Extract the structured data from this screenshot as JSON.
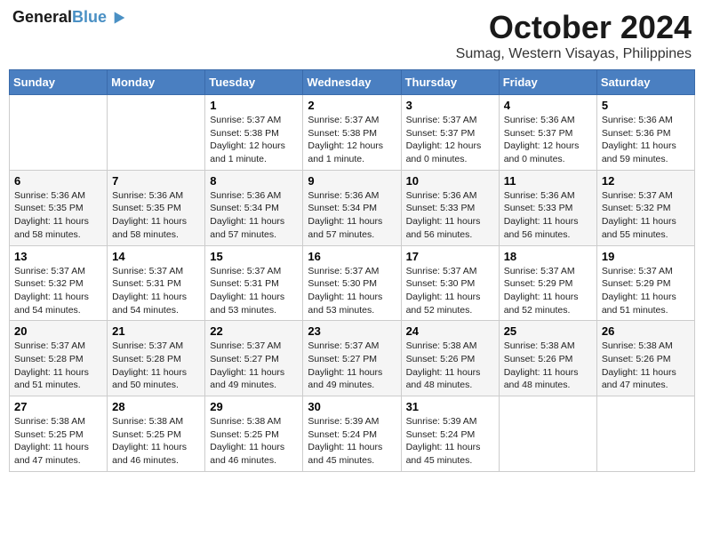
{
  "header": {
    "logo_line1": "General",
    "logo_line2": "Blue",
    "month_title": "October 2024",
    "location": "Sumag, Western Visayas, Philippines"
  },
  "weekdays": [
    "Sunday",
    "Monday",
    "Tuesday",
    "Wednesday",
    "Thursday",
    "Friday",
    "Saturday"
  ],
  "weeks": [
    [
      {
        "day": "",
        "text": ""
      },
      {
        "day": "",
        "text": ""
      },
      {
        "day": "1",
        "text": "Sunrise: 5:37 AM\nSunset: 5:38 PM\nDaylight: 12 hours\nand 1 minute."
      },
      {
        "day": "2",
        "text": "Sunrise: 5:37 AM\nSunset: 5:38 PM\nDaylight: 12 hours\nand 1 minute."
      },
      {
        "day": "3",
        "text": "Sunrise: 5:37 AM\nSunset: 5:37 PM\nDaylight: 12 hours\nand 0 minutes."
      },
      {
        "day": "4",
        "text": "Sunrise: 5:36 AM\nSunset: 5:37 PM\nDaylight: 12 hours\nand 0 minutes."
      },
      {
        "day": "5",
        "text": "Sunrise: 5:36 AM\nSunset: 5:36 PM\nDaylight: 11 hours\nand 59 minutes."
      }
    ],
    [
      {
        "day": "6",
        "text": "Sunrise: 5:36 AM\nSunset: 5:35 PM\nDaylight: 11 hours\nand 58 minutes."
      },
      {
        "day": "7",
        "text": "Sunrise: 5:36 AM\nSunset: 5:35 PM\nDaylight: 11 hours\nand 58 minutes."
      },
      {
        "day": "8",
        "text": "Sunrise: 5:36 AM\nSunset: 5:34 PM\nDaylight: 11 hours\nand 57 minutes."
      },
      {
        "day": "9",
        "text": "Sunrise: 5:36 AM\nSunset: 5:34 PM\nDaylight: 11 hours\nand 57 minutes."
      },
      {
        "day": "10",
        "text": "Sunrise: 5:36 AM\nSunset: 5:33 PM\nDaylight: 11 hours\nand 56 minutes."
      },
      {
        "day": "11",
        "text": "Sunrise: 5:36 AM\nSunset: 5:33 PM\nDaylight: 11 hours\nand 56 minutes."
      },
      {
        "day": "12",
        "text": "Sunrise: 5:37 AM\nSunset: 5:32 PM\nDaylight: 11 hours\nand 55 minutes."
      }
    ],
    [
      {
        "day": "13",
        "text": "Sunrise: 5:37 AM\nSunset: 5:32 PM\nDaylight: 11 hours\nand 54 minutes."
      },
      {
        "day": "14",
        "text": "Sunrise: 5:37 AM\nSunset: 5:31 PM\nDaylight: 11 hours\nand 54 minutes."
      },
      {
        "day": "15",
        "text": "Sunrise: 5:37 AM\nSunset: 5:31 PM\nDaylight: 11 hours\nand 53 minutes."
      },
      {
        "day": "16",
        "text": "Sunrise: 5:37 AM\nSunset: 5:30 PM\nDaylight: 11 hours\nand 53 minutes."
      },
      {
        "day": "17",
        "text": "Sunrise: 5:37 AM\nSunset: 5:30 PM\nDaylight: 11 hours\nand 52 minutes."
      },
      {
        "day": "18",
        "text": "Sunrise: 5:37 AM\nSunset: 5:29 PM\nDaylight: 11 hours\nand 52 minutes."
      },
      {
        "day": "19",
        "text": "Sunrise: 5:37 AM\nSunset: 5:29 PM\nDaylight: 11 hours\nand 51 minutes."
      }
    ],
    [
      {
        "day": "20",
        "text": "Sunrise: 5:37 AM\nSunset: 5:28 PM\nDaylight: 11 hours\nand 51 minutes."
      },
      {
        "day": "21",
        "text": "Sunrise: 5:37 AM\nSunset: 5:28 PM\nDaylight: 11 hours\nand 50 minutes."
      },
      {
        "day": "22",
        "text": "Sunrise: 5:37 AM\nSunset: 5:27 PM\nDaylight: 11 hours\nand 49 minutes."
      },
      {
        "day": "23",
        "text": "Sunrise: 5:37 AM\nSunset: 5:27 PM\nDaylight: 11 hours\nand 49 minutes."
      },
      {
        "day": "24",
        "text": "Sunrise: 5:38 AM\nSunset: 5:26 PM\nDaylight: 11 hours\nand 48 minutes."
      },
      {
        "day": "25",
        "text": "Sunrise: 5:38 AM\nSunset: 5:26 PM\nDaylight: 11 hours\nand 48 minutes."
      },
      {
        "day": "26",
        "text": "Sunrise: 5:38 AM\nSunset: 5:26 PM\nDaylight: 11 hours\nand 47 minutes."
      }
    ],
    [
      {
        "day": "27",
        "text": "Sunrise: 5:38 AM\nSunset: 5:25 PM\nDaylight: 11 hours\nand 47 minutes."
      },
      {
        "day": "28",
        "text": "Sunrise: 5:38 AM\nSunset: 5:25 PM\nDaylight: 11 hours\nand 46 minutes."
      },
      {
        "day": "29",
        "text": "Sunrise: 5:38 AM\nSunset: 5:25 PM\nDaylight: 11 hours\nand 46 minutes."
      },
      {
        "day": "30",
        "text": "Sunrise: 5:39 AM\nSunset: 5:24 PM\nDaylight: 11 hours\nand 45 minutes."
      },
      {
        "day": "31",
        "text": "Sunrise: 5:39 AM\nSunset: 5:24 PM\nDaylight: 11 hours\nand 45 minutes."
      },
      {
        "day": "",
        "text": ""
      },
      {
        "day": "",
        "text": ""
      }
    ]
  ]
}
